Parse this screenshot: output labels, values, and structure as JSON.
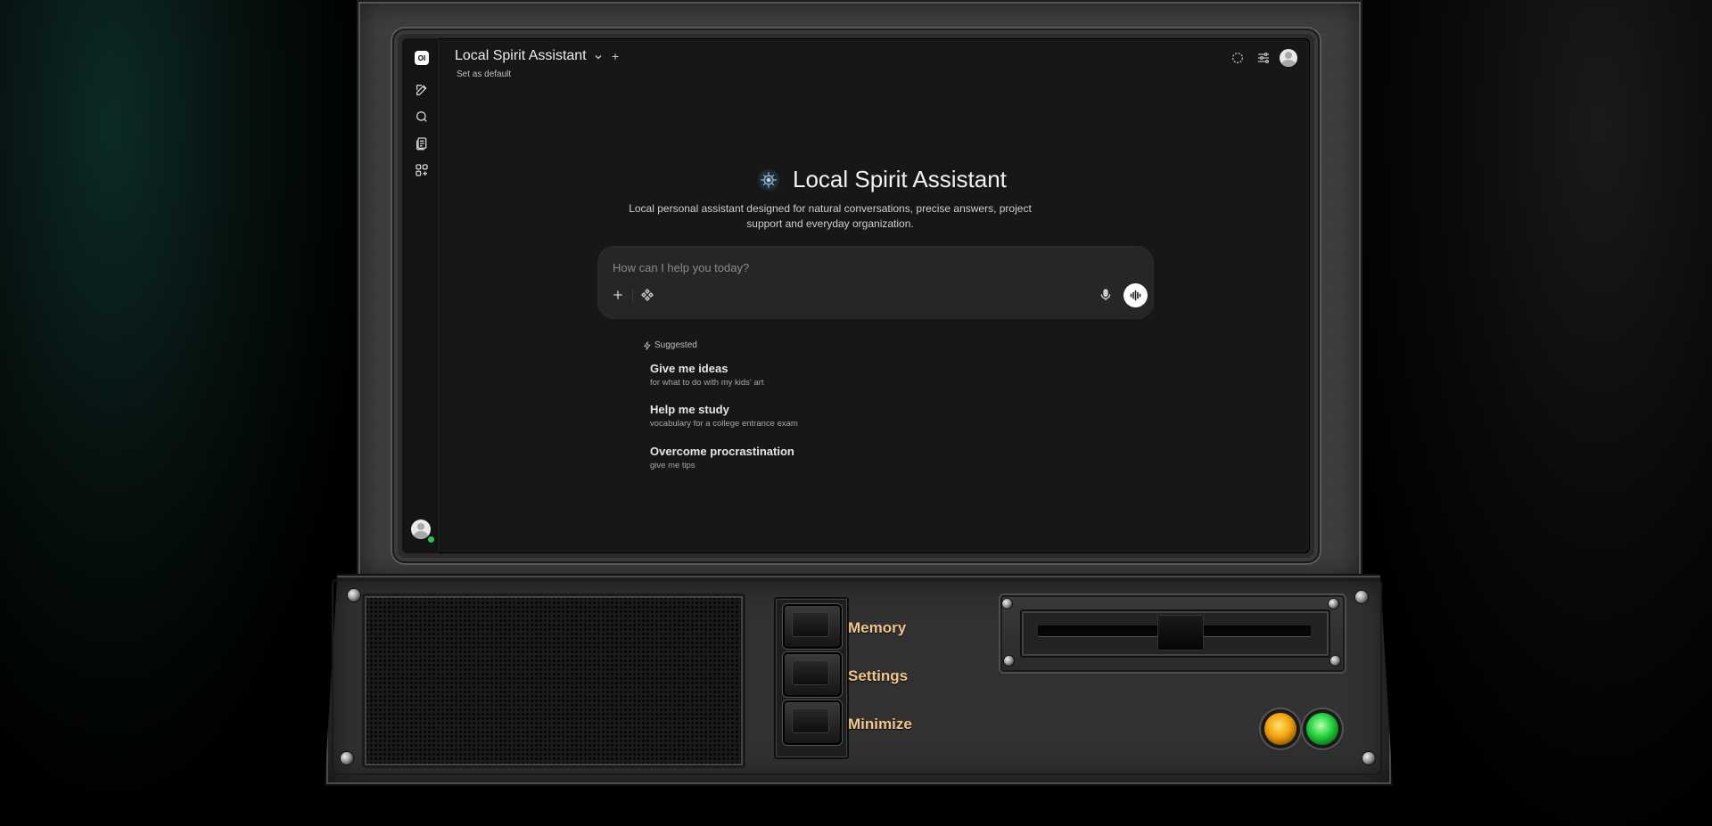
{
  "sidebar": {
    "logo": "OI",
    "items": [
      {
        "icon": "pencil-square-icon"
      },
      {
        "icon": "search-icon"
      },
      {
        "icon": "notes-icon"
      },
      {
        "icon": "workspace-icon"
      }
    ]
  },
  "header": {
    "model_name": "Local Spirit Assistant",
    "set_default": "Set as default"
  },
  "hero": {
    "title": "Local Spirit Assistant",
    "description": "Local personal assistant designed for natural conversations, precise answers, project support and everyday organization."
  },
  "input": {
    "placeholder": "How can I help you today?",
    "value": ""
  },
  "suggested": {
    "heading": "Suggested",
    "items": [
      {
        "title": "Give me ideas",
        "subtitle": "for what to do with my kids' art"
      },
      {
        "title": "Help me study",
        "subtitle": "vocabulary for a college entrance exam"
      },
      {
        "title": "Overcome procrastination",
        "subtitle": "give me tips"
      }
    ]
  },
  "hardware": {
    "buttons": [
      {
        "label": "Memory"
      },
      {
        "label": "Settings"
      },
      {
        "label": "Minimize"
      }
    ],
    "led_colors": {
      "amber": "#f2a20c",
      "green": "#1fd13a"
    },
    "label_color": "#f2c68b"
  },
  "colors": {
    "status_online": "#22c55e",
    "screen_bg": "#171717"
  }
}
